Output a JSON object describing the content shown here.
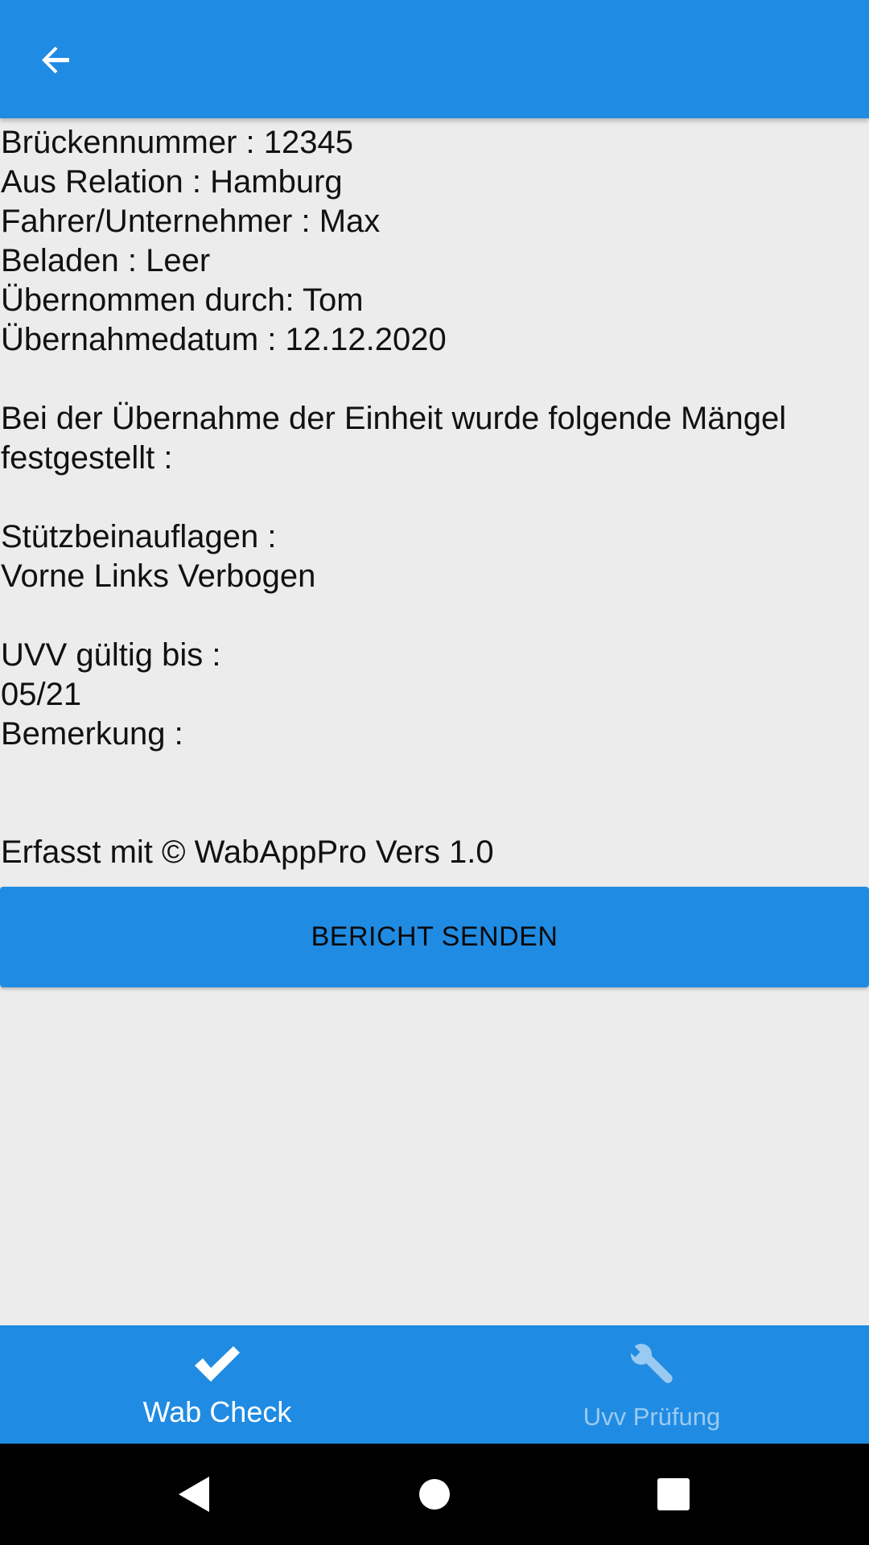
{
  "app_bar": {
    "back_icon": "arrow-left-icon",
    "color": "#208be2"
  },
  "report": {
    "lines": [
      "Brückennummer : 12345",
      "Aus Relation : Hamburg",
      "Fahrer/Unternehmer : Max",
      "Beladen : Leer",
      "Übernommen durch: Tom",
      "Übernahmedatum : 12.12.2020"
    ],
    "intro": "Bei der Übernahme der Einheit wurde folgende Mängel festgestellt :",
    "defect_heading": "Stützbeinauflagen :",
    "defect_value": "Vorne Links Verbogen",
    "uvv_heading": "UVV gültig bis :",
    "uvv_value": "05/21",
    "remark_label": "Bemerkung :",
    "footer": "Erfasst mit © WabAppPro Vers 1.0"
  },
  "send_button": {
    "label": "BERICHT SENDEN"
  },
  "bottom_nav": {
    "items": [
      {
        "label": "Wab Check",
        "icon": "checkmark-icon",
        "active": true
      },
      {
        "label": "Uvv Prüfung",
        "icon": "wrench-icon",
        "active": false
      }
    ]
  },
  "system_nav": {
    "icons": [
      "back-triangle-icon",
      "home-circle-icon",
      "recents-square-icon"
    ]
  }
}
